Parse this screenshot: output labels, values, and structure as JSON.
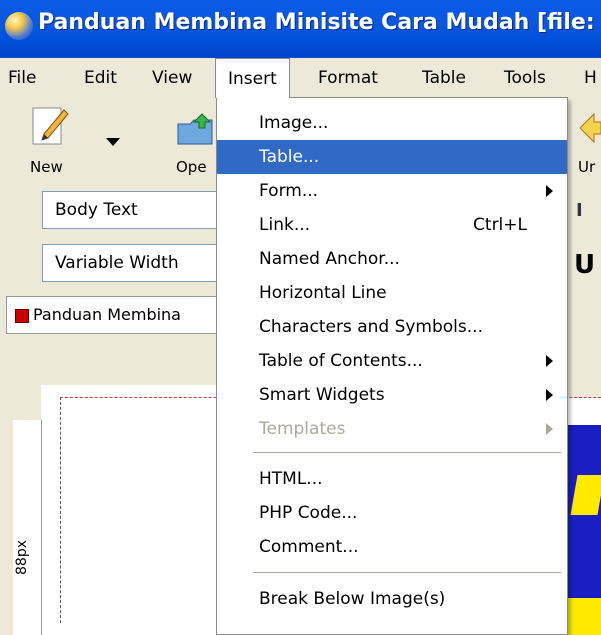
{
  "title_bar": {
    "title": "Panduan Membina Minisite Cara Mudah [file:"
  },
  "menubar": {
    "file": "File",
    "edit": "Edit",
    "view": "View",
    "insert": "Insert",
    "format": "Format",
    "table": "Table",
    "tools": "Tools",
    "help": "H"
  },
  "toolbar": {
    "new_label": "New",
    "open_label": "Ope",
    "undo_label": "Ur"
  },
  "style_combo": {
    "value": "Body Text"
  },
  "width_combo": {
    "value": "Variable Width"
  },
  "document": {
    "tab_title": "Panduan Membina",
    "ruler_label": "88px"
  },
  "insert_menu": {
    "items": [
      {
        "label": "Image..."
      },
      {
        "label": "Table..."
      },
      {
        "label": "Form..."
      },
      {
        "label": "Link...",
        "shortcut": "Ctrl+L"
      },
      {
        "label": "Named Anchor..."
      },
      {
        "label": "Horizontal Line"
      },
      {
        "label": "Characters and Symbols..."
      },
      {
        "label": "Table of Contents..."
      },
      {
        "label": "Smart Widgets"
      },
      {
        "label": "Templates"
      },
      {
        "label": "HTML..."
      },
      {
        "label": "PHP Code..."
      },
      {
        "label": "Comment..."
      },
      {
        "label": "Break Below Image(s)"
      }
    ]
  },
  "colors": {
    "titlebar": "#0a58e0",
    "highlight": "#316ac5",
    "menu_bg": "#ece9d8"
  }
}
